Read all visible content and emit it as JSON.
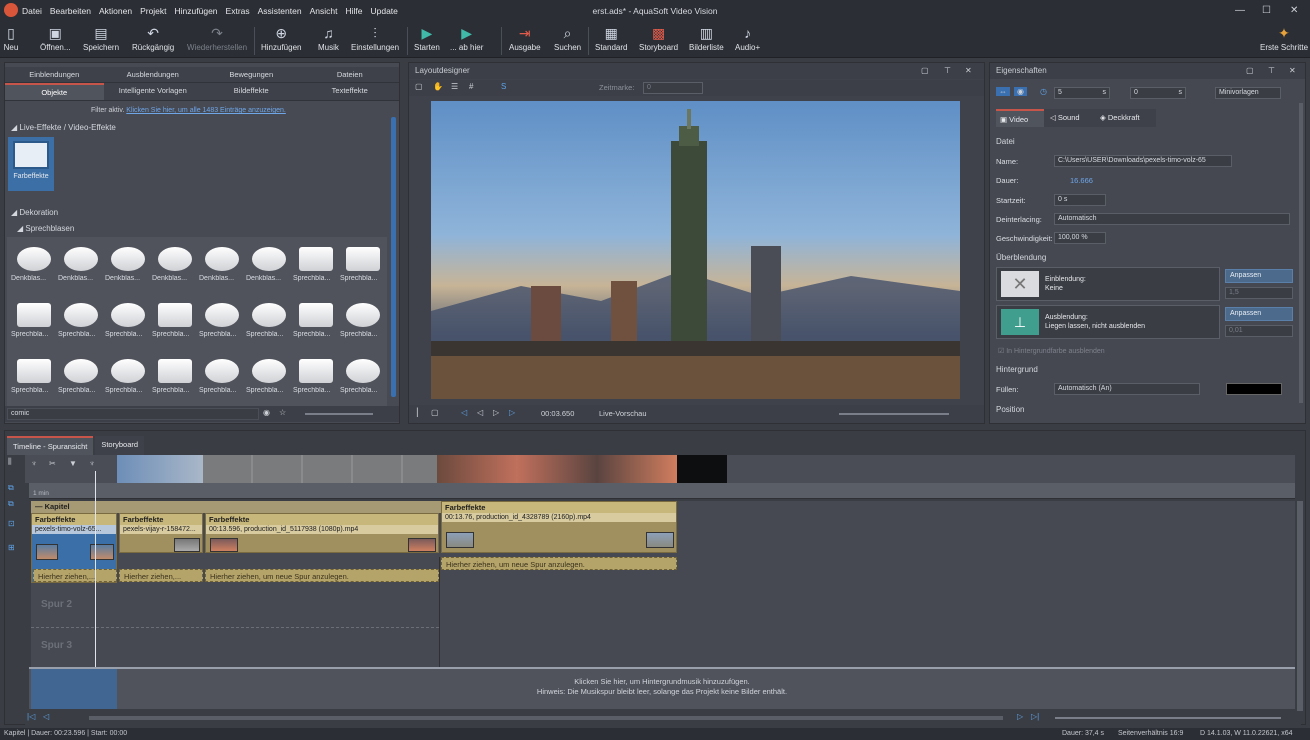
{
  "window": {
    "title": "erst.ads* - AquaSoft Video Vision"
  },
  "menu": [
    "Datei",
    "Bearbeiten",
    "Aktionen",
    "Projekt",
    "Hinzufügen",
    "Extras",
    "Assistenten",
    "Ansicht",
    "Hilfe",
    "Update"
  ],
  "toolbar": {
    "neu": "Neu",
    "oeffnen": "Öffnen...",
    "speichern": "Speichern",
    "rueckgaengig": "Rückgängig",
    "wiederherstellen": "Wiederherstellen",
    "hinzufuegen": "Hinzufügen",
    "musik": "Musik",
    "einstellungen": "Einstellungen",
    "starten": "Starten",
    "abhier": "... ab hier",
    "ausgabe": "Ausgabe",
    "suchen": "Suchen",
    "standard": "Standard",
    "storyboard": "Storyboard",
    "bilderliste": "Bilderliste",
    "audio": "Audio+",
    "erste_schritte": "Erste Schritte"
  },
  "left_panel": {
    "tabs_top": [
      "Einblendungen",
      "Ausblendungen",
      "Bewegungen",
      "Dateien"
    ],
    "tabs_bottom": [
      "Objekte",
      "Intelligente Vorlagen",
      "Bildeffekte",
      "Texteffekte"
    ],
    "filter_text": "Filter aktiv.",
    "filter_link": "Klicken Sie hier, um alle 1483 Einträge anzuzeigen.",
    "section_live": "Live-Effekte / Video-Effekte",
    "farbeffekte": "Farbeffekte",
    "section_deko": "Dekoration",
    "section_sprech": "Sprechblasen",
    "row1": [
      "Denkblas...",
      "Denkblas...",
      "Denkblas...",
      "Denkblas...",
      "Denkblas...",
      "Denkblas...",
      "Sprechbla...",
      "Sprechbla..."
    ],
    "row2": [
      "Sprechbla...",
      "Sprechbla...",
      "Sprechbla...",
      "Sprechbla...",
      "Sprechbla...",
      "Sprechbla...",
      "Sprechbla...",
      "Sprechbla..."
    ],
    "row3": [
      "Sprechbla...",
      "Sprechbla...",
      "Sprechbla...",
      "Sprechbla...",
      "Sprechbla...",
      "Sprechbla...",
      "Sprechbla...",
      "Sprechbla..."
    ],
    "search_value": "comic"
  },
  "layout": {
    "title": "Layoutdesigner",
    "zeitmarke_label": "Zeitmarke:",
    "zeitmarke_value": "0",
    "time": "00:03.650",
    "live": "Live-Vorschau"
  },
  "props": {
    "title": "Eigenschaften",
    "val1": "5",
    "unit1": "s",
    "val2": "0",
    "unit2": "s",
    "minivorlagen": "Minivorlagen",
    "tabs": [
      "Video",
      "Sound",
      "Deckkraft"
    ],
    "sec_datei": "Datei",
    "name_label": "Name:",
    "name_value": "C:\\Users\\USER\\Downloads\\pexels-timo-volz-65",
    "dauer_label": "Dauer:",
    "dauer_value": "16.666",
    "startzeit_label": "Startzeit:",
    "startzeit_value": "0 s",
    "deinterlacing_label": "Deinterlacing:",
    "deinterlacing_value": "Automatisch",
    "geschw_label": "Geschwindigkeit:",
    "geschw_value": "100,00 %",
    "sec_ueber": "Überblendung",
    "einbl_label": "Einblendung:",
    "einbl_value": "Keine",
    "ausbl_label": "Ausblendung:",
    "ausbl_value": "Liegen lassen, nicht ausblenden",
    "anpassen": "Anpassen",
    "val_15": "1,5",
    "val_001": "0,01",
    "check_label": "In Hintergrundfarbe ausblenden",
    "sec_hg": "Hintergrund",
    "fuellen_label": "Füllen:",
    "fuellen_value": "Automatisch (An)",
    "sec_pos": "Position"
  },
  "timeline": {
    "tabs": [
      "Timeline - Spuransicht",
      "Storyboard"
    ],
    "ruler_min": "1 min",
    "kapitel": "Kapitel",
    "clip1_head": "Farbeffekte",
    "clip1_name": "pexels-timo-volz-65...",
    "clip2_head": "Farbeffekte",
    "clip2_name": "pexels-vijay-r-158472...",
    "clip3_head": "Farbeffekte",
    "clip3_name": "00:13.596, production_id_5117938 (1080p).mp4",
    "clip4_head": "Farbeffekte",
    "clip4_name": "00:13.76, production_id_4328789 (2160p).mp4",
    "drop_short": "Hierher ziehen,...",
    "drop_long": "Hierher ziehen, um neue Spur anzulegen.",
    "spur2": "Spur 2",
    "spur3": "Spur 3",
    "music_hint1": "Klicken Sie hier, um Hintergrundmusik hinzuzufügen.",
    "music_hint2": "Hinweis: Die Musikspur bleibt leer, solange das Projekt keine Bilder enthält."
  },
  "status": {
    "left": "Kapitel | Dauer: 00:23.596 | Start: 00:00",
    "dauer": "Dauer: 37,4 s",
    "seiten": "Seitenverhältnis 16:9",
    "build": "D 14.1.03, W 11.0.22621, x64"
  }
}
